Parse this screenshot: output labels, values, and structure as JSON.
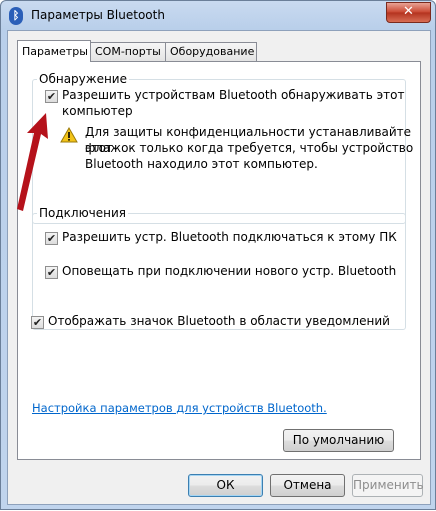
{
  "window": {
    "title": "Параметры Bluetooth",
    "icon": "bluetooth-icon",
    "close_glyph": "✕"
  },
  "tabs": [
    {
      "label": "Параметры",
      "active": true
    },
    {
      "label": "COM-порты",
      "active": false
    },
    {
      "label": "Оборудование",
      "active": false
    }
  ],
  "discovery": {
    "legend": "Обнаружение",
    "allow_discovery": {
      "checked": true,
      "label_line1": "Разрешить устройствам Bluetooth обнаруживать этот",
      "label_line2": "компьютер"
    },
    "warning": {
      "line1": "Для защиты конфиденциальности устанавливайте этот",
      "line2": "флажок только когда требуется, чтобы устройство",
      "line3": "Bluetooth находило этот компьютер."
    }
  },
  "connections": {
    "legend": "Подключения",
    "allow_connect": {
      "checked": true,
      "label": "Разрешить устр. Bluetooth подключаться к этому ПК"
    },
    "notify_new": {
      "checked": true,
      "label": "Оповещать при подключении нового устр. Bluetooth"
    }
  },
  "show_icon": {
    "checked": true,
    "label": "Отображать значок Bluetooth в области уведомлений"
  },
  "settings_link": "Настройка параметров для устройств Bluetooth.",
  "buttons": {
    "defaults": "По умолчанию",
    "ok": "ОК",
    "cancel": "Отмена",
    "apply": "Применить"
  },
  "check_glyph": "✔",
  "colors": {
    "arrow": "#b5121b",
    "link": "#0066cc"
  }
}
